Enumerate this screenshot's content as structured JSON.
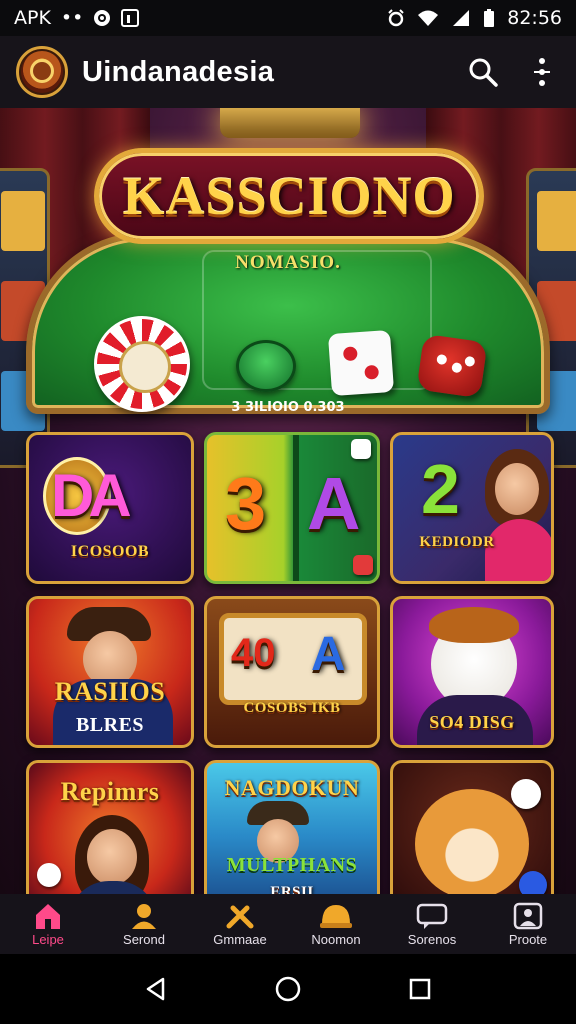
{
  "status_bar": {
    "apk_label": "APK",
    "dots": "••",
    "time": "82:56"
  },
  "app_bar": {
    "title": "Uindanadesia",
    "icons": [
      "app-logo",
      "search-icon",
      "more-icon"
    ]
  },
  "hero": {
    "logo_text": "KASSCIONO",
    "subtitle": "NOMASIO.",
    "caption": "3 3ILIOIO 0.303"
  },
  "games": [
    {
      "id": "da",
      "glyphs": "DA",
      "label": "ICOSOOB"
    },
    {
      "id": "3a",
      "glyphs": [
        "3",
        "A"
      ],
      "label": ""
    },
    {
      "id": "2",
      "glyphs": "2",
      "label": "KEDIODR"
    },
    {
      "id": "rasiios",
      "title": "RASIIOS",
      "label": "BLRES"
    },
    {
      "id": "slot-40a",
      "glyphs": [
        "40",
        "A"
      ],
      "label": "COSOBS IKB"
    },
    {
      "id": "dog-suit",
      "label": "SO4 DISG"
    },
    {
      "id": "repimrs",
      "title": "Repimrs",
      "label": ""
    },
    {
      "id": "nagdokun",
      "title": "NAGDOKUN",
      "subtitle": "MULTPHANS",
      "label": "ERSII"
    },
    {
      "id": "shiba",
      "label": ""
    }
  ],
  "bottom_nav": [
    {
      "label": "Leipe",
      "icon": "home-icon",
      "active": true
    },
    {
      "label": "Serond",
      "icon": "person-icon",
      "active": false
    },
    {
      "label": "Gmmaae",
      "icon": "tools-icon",
      "active": false
    },
    {
      "label": "Noomon",
      "icon": "helmet-icon",
      "active": false
    },
    {
      "label": "Sorenos",
      "icon": "chat-icon",
      "active": false
    },
    {
      "label": "Proote",
      "icon": "profile-icon",
      "active": false
    }
  ],
  "colors": {
    "accent_gold": "#d9a23a",
    "active_pink": "#ff4a8a",
    "felt_green": "#1f8a2c"
  }
}
